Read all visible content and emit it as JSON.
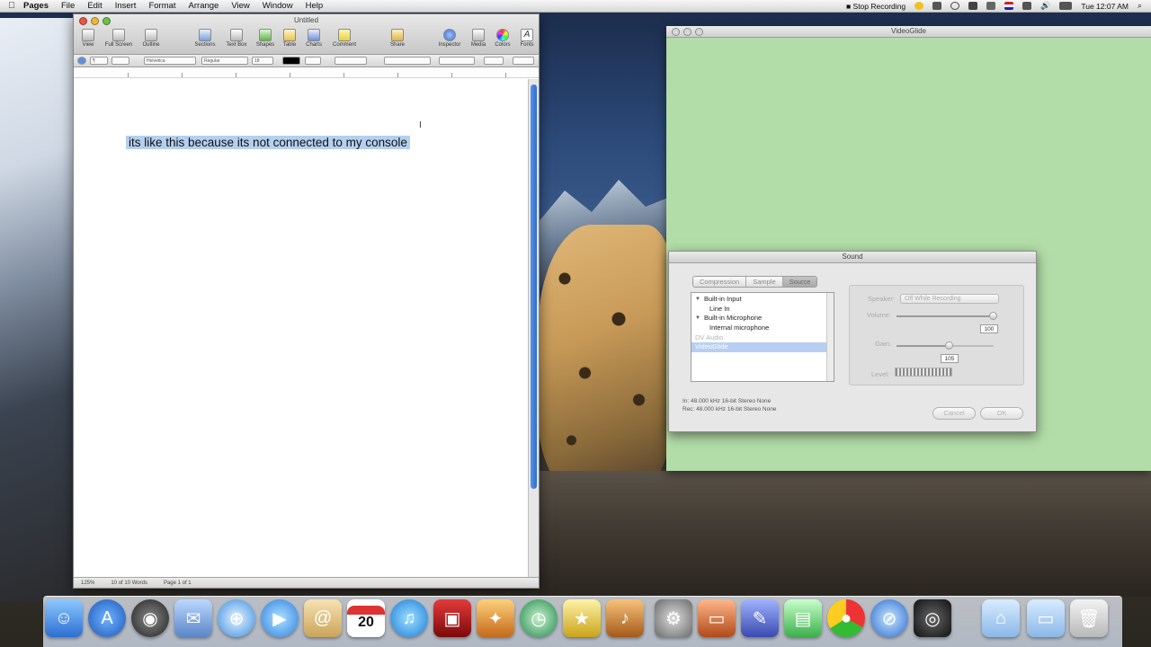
{
  "menubar": {
    "app": "Pages",
    "items": [
      "File",
      "Edit",
      "Insert",
      "Format",
      "Arrange",
      "View",
      "Window",
      "Help"
    ],
    "status_recording": "Stop Recording",
    "clock": "Tue 12:07 AM"
  },
  "pages_window": {
    "title": "Untitled",
    "toolbar": [
      "View",
      "Full Screen",
      "Outline",
      "Sections",
      "Text Box",
      "Shapes",
      "Table",
      "Charts",
      "Comment",
      "Share",
      "Inspector",
      "Media",
      "Colors",
      "Fonts"
    ],
    "format": {
      "style": "¶",
      "font": "Helvetica",
      "typeface": "Regular",
      "size": "18"
    },
    "document_text": "its like this because its not connected to my console",
    "status_zoom": "125%",
    "status_words": "10 of 10 Words",
    "status_page": "Page 1 of 1"
  },
  "videoglide_window": {
    "title": "VideoGlide"
  },
  "sound_dialog": {
    "title": "Sound",
    "tabs": [
      "Compression",
      "Sample",
      "Source"
    ],
    "active_tab": "Source",
    "sources": [
      {
        "label": "Built-in Input",
        "level": 0,
        "expandable": true
      },
      {
        "label": "Line In",
        "level": 1
      },
      {
        "label": "Built-in Microphone",
        "level": 0,
        "expandable": true
      },
      {
        "label": "Internal microphone",
        "level": 1
      },
      {
        "label": "DV Audio",
        "level": 0,
        "disabled": true
      },
      {
        "label": "VideoGlide",
        "level": 0,
        "selected": true
      }
    ],
    "speaker_label": "Speaker:",
    "speaker_value": "Off While Recording",
    "volume_label": "Volume:",
    "volume_value": "100",
    "volume_fraction": 1.0,
    "gain_label": "Gain:",
    "gain_value": "105",
    "gain_fraction": 0.55,
    "level_label": "Level:",
    "info_in": "In: 48.000 kHz 16-bit Stereo None",
    "info_rec": "Rec: 48.000 kHz 16-bit Stereo None",
    "cancel_label": "Cancel",
    "ok_label": "OK"
  },
  "dock": {
    "calendar_day": "20"
  },
  "colors": {
    "selection": "#b4d0f0",
    "videoglide_bg": "#b2dca8",
    "scroll_thumb": "#2b6cd4"
  }
}
